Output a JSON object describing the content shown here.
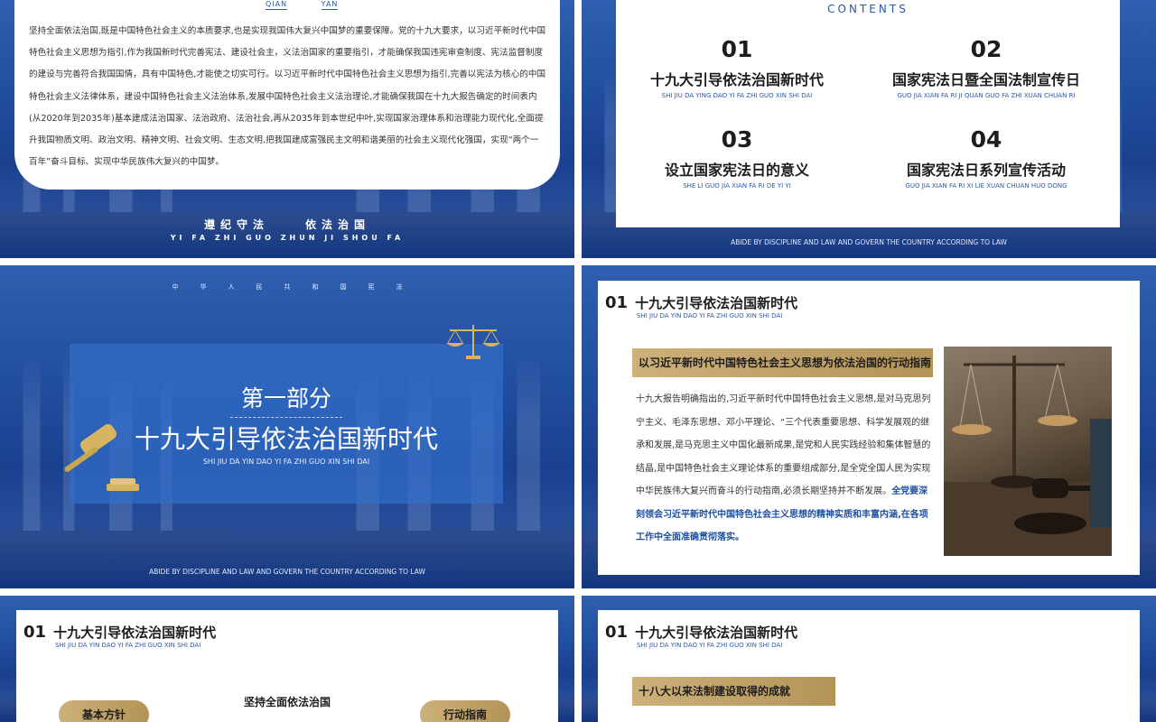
{
  "slide1": {
    "tabs": [
      "QIAN",
      "YAN"
    ],
    "paragraph": "坚持全面依法治国,既是中国特色社会主义的本质要求,也是实现我国伟大复兴中国梦的重要保障。党的十九大要求，以习近平新时代中国特色社会主义思想为指引,作为我国新时代完善宪法、建设社会主，义法治国家的重要指引，才能确保我国违宪审查制度、宪法监督制度的建设与完善符合我国国情，具有中国特色,才能使之切实可行。以习近平新时代中国特色社会主义思想为指引,完善以宪法为核心的中国特色社会主义法律体系，建设中国特色社会主义法治体系,发展中国特色社会主义法治理论,才能确保我国在十九大报告确定的时间表内(从2020年到2035年)基本建成法治国家、法治政府、法治社会,再从2035年到本世纪中叶,实现国家治理体系和治理能力现代化,全面提升我国物质文明、政治文明、精神文明、社会文明、生态文明,把我国建成富强民主文明和谐美丽的社会主义现代化强国，实现“两个一百年”奋斗目标、实现中华民族伟大复兴的中国梦。",
    "motto_a": "遵纪守法",
    "motto_b": "依法治国",
    "motto_pinyin": "YI FA ZHI GUO ZHUN JI SHOU FA"
  },
  "slide2": {
    "contents_label": "CONTENTS",
    "items": [
      {
        "num": "01",
        "title": "十九大引导依法治国新时代",
        "pinyin": "SHI JIU DA YING DAO YI FA ZHI GUO XIN SHI DAI"
      },
      {
        "num": "02",
        "title": "国家宪法日暨全国法制宣传日",
        "pinyin": "GUO JIA XIAN FA RI JI QUAN GUO FA ZHI XUAN CHUAN RI"
      },
      {
        "num": "03",
        "title": "设立国家宪法日的意义",
        "pinyin": "SHE LI GUO JIA XIAN FA RI DE YI YI"
      },
      {
        "num": "04",
        "title": "国家宪法日系列宣传活动",
        "pinyin": "GUO JIA XIAN FA RI XI LIE XUAN CHUAN HUO DONG"
      }
    ],
    "footer": "ABIDE BY DISCIPLINE AND LAW AND GOVERN THE COUNTRY ACCORDING TO LAW"
  },
  "slide3": {
    "top_chars": [
      "中",
      "华",
      "人",
      "民",
      "共",
      "和",
      "国",
      "宪",
      "法"
    ],
    "part": "第一部分",
    "title": "十九大引导依法治国新时代",
    "pinyin": "SHI JIU DA YIN DAO YI FA ZHI GUO XIN SHI DAI",
    "footer": "ABIDE BY DISCIPLINE AND LAW AND GOVERN THE COUNTRY ACCORDING TO LAW"
  },
  "section_header": {
    "num": "01",
    "title": "十九大引导依法治国新时代",
    "pinyin": "SHI JIU DA YIN DAO YI FA ZHI GUO XIN SHI DAI"
  },
  "slide4": {
    "banner": "以习近平新时代中国特色社会主义思想为依法治国的行动指南",
    "body": "十九大报告明确指出的,习近平新时代中国特色社会主义思想,是对马克思列宁主义、毛泽东思想、邓小平理论、“三个代表重要思想、科学发展观的继承和发展,是马克思主义中国化最新成果,是党和人民实践经验和集体智慧的结晶,是中国特色社会主义理论体系的重要组成部分,是全党全国人民为实现中华民族伟大复兴而奋斗的行动指南,必须长期坚持并不断发展。",
    "highlight": "全党要深刻领会习近平新时代中国特色社会主义思想的精神实质和丰富内涵,在各项工作中全面准确贯彻落实。"
  },
  "slide5": {
    "left_pill": "基本方针",
    "center": "坚持全面依法治国",
    "right_pill": "行动指南"
  },
  "slide6": {
    "banner": "十八大以来法制建设取得的成就"
  },
  "colors": {
    "blue_bg": "#1f4a9a",
    "gold": "#b49357",
    "accent_blue": "#2a58a8"
  }
}
